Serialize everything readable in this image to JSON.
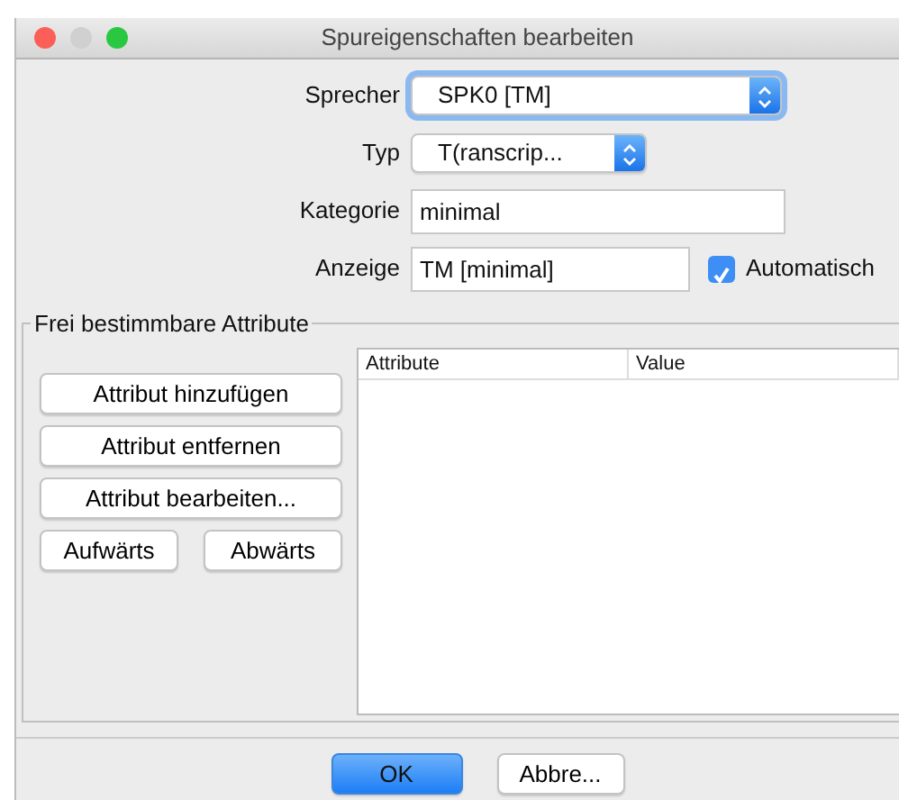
{
  "window": {
    "title": "Spureigenschaften bearbeiten"
  },
  "fields": [
    {
      "label": "Sprecher",
      "kind": "select",
      "value": "SPK0 [TM]",
      "focused": true
    },
    {
      "label": "Typ",
      "kind": "select",
      "value": "T(ranscrip...",
      "focused": false
    },
    {
      "label": "Kategorie",
      "kind": "text",
      "value": "minimal"
    },
    {
      "label": "Anzeige",
      "kind": "text",
      "value": "TM [minimal]",
      "checkbox": {
        "label": "Automatisch",
        "checked": true
      }
    }
  ],
  "attributes_group": {
    "title": "Frei bestimmbare Attribute",
    "buttons": [
      "Attribut hinzufügen",
      "Attribut entfernen",
      "Attribut bearbeiten..."
    ],
    "move_buttons": [
      "Aufwärts",
      "Abwärts"
    ],
    "table": {
      "columns": [
        "Attribute",
        "Value"
      ]
    }
  },
  "buttons": [
    {
      "label": "OK",
      "default": true
    },
    {
      "label": "Abbre...",
      "default": false
    }
  ]
}
